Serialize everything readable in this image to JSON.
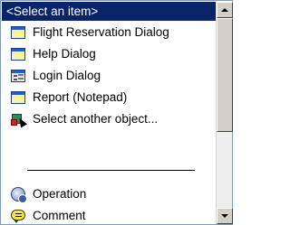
{
  "list": {
    "items": [
      {
        "label": "<Select an item>",
        "icon": "",
        "selected": true
      },
      {
        "label": "Flight Reservation Dialog",
        "icon": "window-icon"
      },
      {
        "label": "Help Dialog",
        "icon": "window-icon"
      },
      {
        "label": "Login Dialog",
        "icon": "form-icon"
      },
      {
        "label": "Report (Notepad)",
        "icon": "window-icon"
      },
      {
        "label": "Select another object...",
        "icon": "object-picker-icon"
      },
      {
        "label": "Operation",
        "icon": "operation-icon"
      },
      {
        "label": "Comment",
        "icon": "comment-icon"
      }
    ]
  },
  "colors": {
    "selection_bg": "#0a246a",
    "selection_text": "#ffffff"
  }
}
